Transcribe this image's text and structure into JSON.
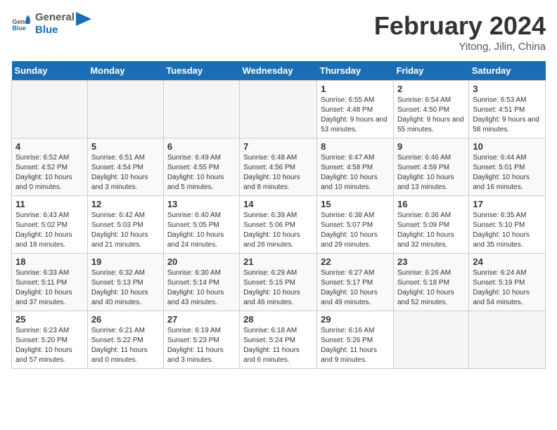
{
  "header": {
    "logo": {
      "general": "General",
      "blue": "Blue"
    },
    "month": "February 2024",
    "location": "Yitong, Jilin, China"
  },
  "weekdays": [
    "Sunday",
    "Monday",
    "Tuesday",
    "Wednesday",
    "Thursday",
    "Friday",
    "Saturday"
  ],
  "weeks": [
    [
      {
        "day": "",
        "info": ""
      },
      {
        "day": "",
        "info": ""
      },
      {
        "day": "",
        "info": ""
      },
      {
        "day": "",
        "info": ""
      },
      {
        "day": "1",
        "info": "Sunrise: 6:55 AM\nSunset: 4:48 PM\nDaylight: 9 hours and 53 minutes."
      },
      {
        "day": "2",
        "info": "Sunrise: 6:54 AM\nSunset: 4:50 PM\nDaylight: 9 hours and 55 minutes."
      },
      {
        "day": "3",
        "info": "Sunrise: 6:53 AM\nSunset: 4:51 PM\nDaylight: 9 hours and 58 minutes."
      }
    ],
    [
      {
        "day": "4",
        "info": "Sunrise: 6:52 AM\nSunset: 4:52 PM\nDaylight: 10 hours and 0 minutes."
      },
      {
        "day": "5",
        "info": "Sunrise: 6:51 AM\nSunset: 4:54 PM\nDaylight: 10 hours and 3 minutes."
      },
      {
        "day": "6",
        "info": "Sunrise: 6:49 AM\nSunset: 4:55 PM\nDaylight: 10 hours and 5 minutes."
      },
      {
        "day": "7",
        "info": "Sunrise: 6:48 AM\nSunset: 4:56 PM\nDaylight: 10 hours and 8 minutes."
      },
      {
        "day": "8",
        "info": "Sunrise: 6:47 AM\nSunset: 4:58 PM\nDaylight: 10 hours and 10 minutes."
      },
      {
        "day": "9",
        "info": "Sunrise: 6:46 AM\nSunset: 4:59 PM\nDaylight: 10 hours and 13 minutes."
      },
      {
        "day": "10",
        "info": "Sunrise: 6:44 AM\nSunset: 5:01 PM\nDaylight: 10 hours and 16 minutes."
      }
    ],
    [
      {
        "day": "11",
        "info": "Sunrise: 6:43 AM\nSunset: 5:02 PM\nDaylight: 10 hours and 18 minutes."
      },
      {
        "day": "12",
        "info": "Sunrise: 6:42 AM\nSunset: 5:03 PM\nDaylight: 10 hours and 21 minutes."
      },
      {
        "day": "13",
        "info": "Sunrise: 6:40 AM\nSunset: 5:05 PM\nDaylight: 10 hours and 24 minutes."
      },
      {
        "day": "14",
        "info": "Sunrise: 6:39 AM\nSunset: 5:06 PM\nDaylight: 10 hours and 26 minutes."
      },
      {
        "day": "15",
        "info": "Sunrise: 6:38 AM\nSunset: 5:07 PM\nDaylight: 10 hours and 29 minutes."
      },
      {
        "day": "16",
        "info": "Sunrise: 6:36 AM\nSunset: 5:09 PM\nDaylight: 10 hours and 32 minutes."
      },
      {
        "day": "17",
        "info": "Sunrise: 6:35 AM\nSunset: 5:10 PM\nDaylight: 10 hours and 35 minutes."
      }
    ],
    [
      {
        "day": "18",
        "info": "Sunrise: 6:33 AM\nSunset: 5:11 PM\nDaylight: 10 hours and 37 minutes."
      },
      {
        "day": "19",
        "info": "Sunrise: 6:32 AM\nSunset: 5:13 PM\nDaylight: 10 hours and 40 minutes."
      },
      {
        "day": "20",
        "info": "Sunrise: 6:30 AM\nSunset: 5:14 PM\nDaylight: 10 hours and 43 minutes."
      },
      {
        "day": "21",
        "info": "Sunrise: 6:29 AM\nSunset: 5:15 PM\nDaylight: 10 hours and 46 minutes."
      },
      {
        "day": "22",
        "info": "Sunrise: 6:27 AM\nSunset: 5:17 PM\nDaylight: 10 hours and 49 minutes."
      },
      {
        "day": "23",
        "info": "Sunrise: 6:26 AM\nSunset: 5:18 PM\nDaylight: 10 hours and 52 minutes."
      },
      {
        "day": "24",
        "info": "Sunrise: 6:24 AM\nSunset: 5:19 PM\nDaylight: 10 hours and 54 minutes."
      }
    ],
    [
      {
        "day": "25",
        "info": "Sunrise: 6:23 AM\nSunset: 5:20 PM\nDaylight: 10 hours and 57 minutes."
      },
      {
        "day": "26",
        "info": "Sunrise: 6:21 AM\nSunset: 5:22 PM\nDaylight: 11 hours and 0 minutes."
      },
      {
        "day": "27",
        "info": "Sunrise: 6:19 AM\nSunset: 5:23 PM\nDaylight: 11 hours and 3 minutes."
      },
      {
        "day": "28",
        "info": "Sunrise: 6:18 AM\nSunset: 5:24 PM\nDaylight: 11 hours and 6 minutes."
      },
      {
        "day": "29",
        "info": "Sunrise: 6:16 AM\nSunset: 5:26 PM\nDaylight: 11 hours and 9 minutes."
      },
      {
        "day": "",
        "info": ""
      },
      {
        "day": "",
        "info": ""
      }
    ]
  ]
}
